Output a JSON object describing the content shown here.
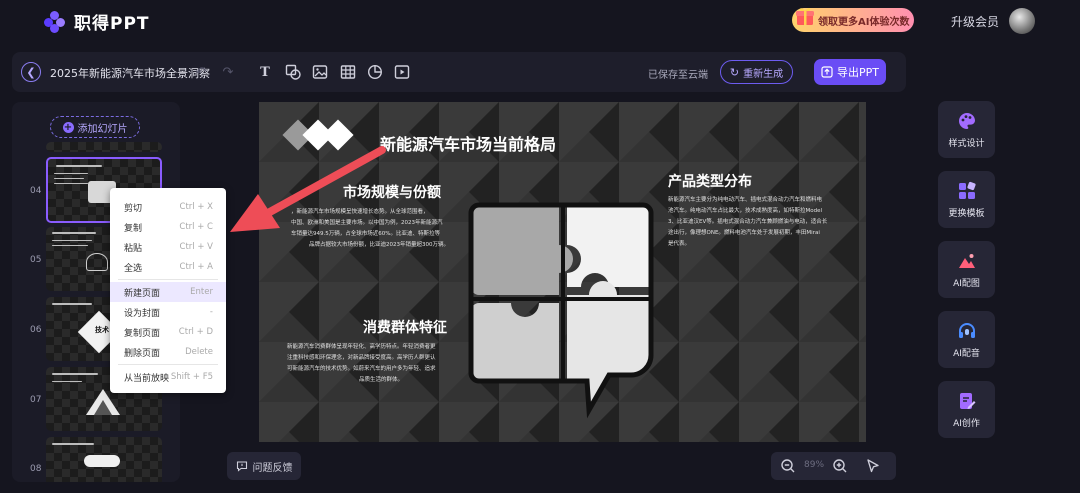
{
  "app": {
    "name": "职得PPT"
  },
  "header": {
    "promo_label": "领取更多AI体验次数",
    "vip_label": "升级会员"
  },
  "toolbar": {
    "title": "2025年新能源汽车市场全景洞察",
    "saved_status": "已保存至云端",
    "regenerate_label": "重新生成",
    "export_label": "导出PPT"
  },
  "sidebar": {
    "add_slide_label": "添加幻灯片",
    "slides": [
      {
        "num": "04",
        "selected": true
      },
      {
        "num": "05",
        "selected": false
      },
      {
        "num": "06",
        "selected": false
      },
      {
        "num": "07",
        "selected": false
      }
    ],
    "slide6_word": "技术"
  },
  "context_menu": {
    "items": [
      {
        "label": "剪切",
        "shortcut": "Ctrl + X"
      },
      {
        "label": "复制",
        "shortcut": "Ctrl + C"
      },
      {
        "label": "粘贴",
        "shortcut": "Ctrl + V"
      },
      {
        "label": "全选",
        "shortcut": "Ctrl + A"
      },
      {
        "label": "新建页面",
        "shortcut": "Enter"
      },
      {
        "label": "设为封面",
        "shortcut": "-"
      },
      {
        "label": "复制页面",
        "shortcut": "Ctrl + D"
      },
      {
        "label": "删除页面",
        "shortcut": "Delete"
      },
      {
        "label": "从当前放映",
        "shortcut": "Shift + F5"
      }
    ]
  },
  "slide": {
    "title": "新能源汽车市场当前格局",
    "section1": {
      "heading": "市场规模与份额",
      "lines": [
        "，新能源汽车市场规模呈快速增长态势。从全球范围看，",
        "中国、欧洲和美国是主要市场。以中国为例，2023年新能源汽",
        "车销量达949.5万辆，占全球市场近60%。比亚迪、特斯拉等",
        "品牌占据较大市场份额，比亚迪2023年销量超300万辆。"
      ]
    },
    "section2": {
      "heading": "产品类型分布",
      "lines": [
        "新能源汽车主要分为纯电动汽车、插电式混合动力汽车和燃料电",
        "池汽车。纯电动汽车占比最大，技术成熟度高，如特斯拉Model",
        "3、比亚迪汉EV等。插电式混合动力汽车兼顾燃油与电动，适合长",
        "途出行，像理想ONE。燃料电池汽车处于发展初期，丰田Mirai",
        "是代表。"
      ]
    },
    "section3": {
      "heading": "消费群体特征",
      "lines": [
        "新能源汽车消费群体呈现年轻化、高学历特点。年轻消费者更",
        "注重科技感和环保理念，对新品牌接受度高。高学历人群更认",
        "可新能源汽车的技术优势。如蔚来汽车的用户多为年轻、追求",
        "品质生活的群体。"
      ]
    }
  },
  "right_tools": [
    {
      "label": "样式设计",
      "icon": "palette-icon",
      "color": "#a26bff"
    },
    {
      "label": "更换模板",
      "icon": "template-icon",
      "color": "#8b6bff"
    },
    {
      "label": "AI配图",
      "icon": "image-icon",
      "color": "#ff5f7a"
    },
    {
      "label": "AI配音",
      "icon": "headphone-icon",
      "color": "#4a8cff"
    },
    {
      "label": "AI创作",
      "icon": "edit-doc-icon",
      "color": "#a26bff"
    }
  ],
  "bottom": {
    "feedback_label": "问题反馈",
    "zoom": "89%"
  },
  "colors": {
    "accent": "#6a4df5",
    "arrow": "#ee4d57"
  }
}
